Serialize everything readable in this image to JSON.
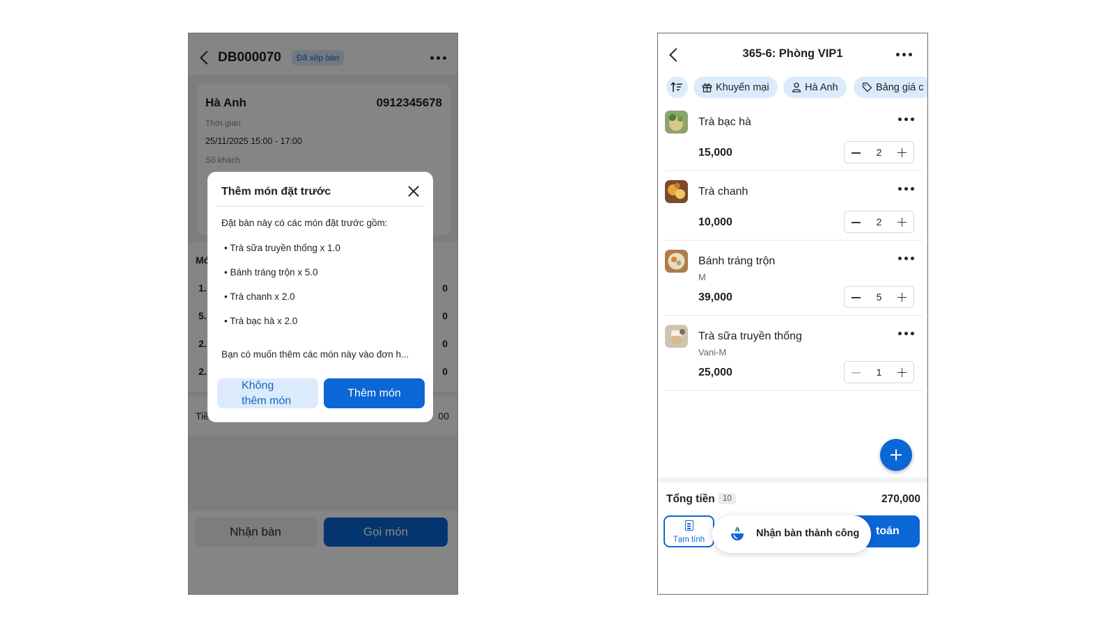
{
  "left_screen": {
    "header": {
      "booking_code": "DB000070",
      "status": "Đã xếp bàn"
    },
    "customer": {
      "name": "Hà Anh",
      "phone": "0912345678",
      "time_label": "Thời gian",
      "time_value": "25/11/2025 15:00 - 17:00",
      "guests_label": "Số khách"
    },
    "list_partial": {
      "title_partial": "Mó",
      "row_prefixes": [
        "1.",
        "5.",
        "2.",
        "2."
      ],
      "row_suffixes": [
        "0",
        "0",
        "0",
        "0"
      ],
      "total_prefix": "Tiề",
      "total_suffix": "00"
    },
    "bottom": {
      "receive_label": "Nhận bàn",
      "order_label": "Gọi món"
    },
    "dialog": {
      "title": "Thêm món đặt trước",
      "intro": "Đặt bàn này có các món đặt trước gồm:",
      "items": [
        "Trà sữa truyền thống x 1.0",
        "Bánh tráng trộn x 5.0",
        "Trà chanh x 2.0",
        "Trà bạc hà x 2.0"
      ],
      "question": "Bạn có muốn thêm các món này vào đơn h...",
      "no_label_line1": "Không",
      "no_label_line2": "thêm món",
      "add_label": "Thêm món"
    }
  },
  "right_screen": {
    "header": {
      "title": "365-6: Phòng VIP1"
    },
    "chips": {
      "promo": "Khuyến mại",
      "customer": "Hà Anh",
      "pricelist": "Bảng giá c"
    },
    "items": [
      {
        "name": "Trà bạc hà",
        "variant": "",
        "price": "15,000",
        "qty": "2"
      },
      {
        "name": "Trà chanh",
        "variant": "",
        "price": "10,000",
        "qty": "2"
      },
      {
        "name": "Bánh tráng trộn",
        "variant": "M",
        "price": "39,000",
        "qty": "5"
      },
      {
        "name": "Trà sữa truyền thống",
        "variant": "Vani-M",
        "price": "25,000",
        "qty": "1"
      }
    ],
    "footer": {
      "total_label": "Tổng tiền",
      "item_count": "10",
      "total_amount": "270,000",
      "draft_label": "Tạm tính",
      "pay_label_partial": "toán"
    },
    "toast": {
      "message": "Nhận bàn thành công"
    }
  },
  "colors": {
    "primary": "#0b66d6",
    "chip_bg": "#dcebfc",
    "overlay": "rgba(0,0,0,0.48)"
  }
}
